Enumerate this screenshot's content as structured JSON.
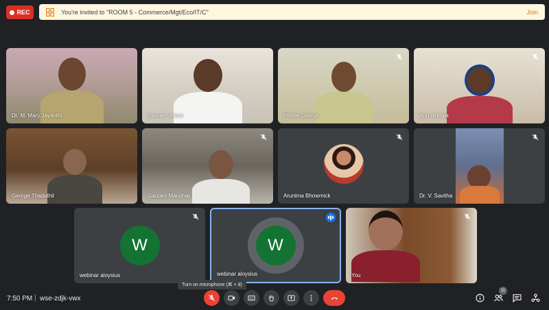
{
  "recording": {
    "label": "REC",
    "color": "#d93025"
  },
  "invite": {
    "text": "You're invited to \"ROOM 5 - Commerce/Mgt/Eco/IT/C\"",
    "join_label": "Join",
    "icon": "breakout-room-icon"
  },
  "tiles": [
    {
      "name": "Dr. M. Mary Jayanthi",
      "muted": false
    },
    {
      "name": "frxavier vedam",
      "muted": false
    },
    {
      "name": "Phebe George",
      "muted": true
    },
    {
      "name": "Ann nirmala",
      "muted": true
    },
    {
      "name": "George Thadathil",
      "muted": false
    },
    {
      "name": "Gautam Manohar",
      "muted": true
    },
    {
      "name": "Arunima Bhowmick",
      "muted": true
    },
    {
      "name": "Dr. V. Savitha",
      "muted": true
    },
    {
      "name": "webinar aloysius",
      "initial": "W",
      "muted": true
    },
    {
      "name": "webinar aloysius",
      "initial": "W",
      "speaking": true
    },
    {
      "name": "You",
      "muted": true
    }
  ],
  "tooltip": "Turn on microphone (⌘ + d)",
  "footer": {
    "time": "7:50 PM",
    "separator": "|",
    "meeting_code": "wse-zdjk-vwx",
    "participants_count": "11"
  },
  "colors": {
    "background": "#202124",
    "tile": "#3c4043",
    "accent": "#1a73e8",
    "end_call": "#ea4335",
    "avatar": "#137333"
  }
}
